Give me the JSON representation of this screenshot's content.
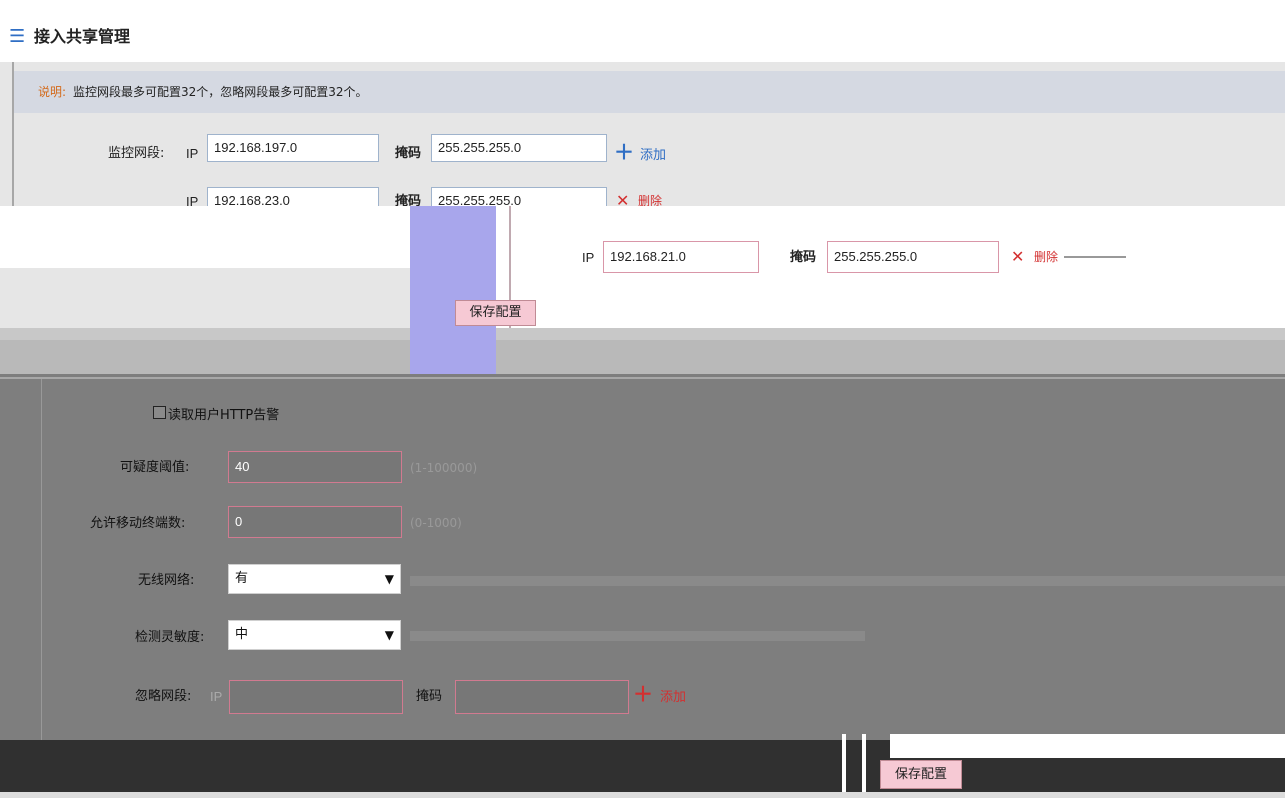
{
  "header": {
    "title": "接入共享管理"
  },
  "notice": {
    "label": "说明:",
    "text": "监控网段最多可配置32个，忽略网段最多可配置32个。"
  },
  "monitor": {
    "label": "监控网段:",
    "ip_prefix": "IP",
    "mask_label": "掩码",
    "rows": [
      {
        "ip": "192.168.197.0",
        "mask": "255.255.255.0",
        "action": "添加"
      },
      {
        "ip": "192.168.23.0",
        "mask": "255.255.255.0",
        "action": "删除"
      },
      {
        "ip": "192.168.21.0",
        "mask": "255.255.255.0",
        "action": "删除"
      }
    ]
  },
  "save_button_1": {
    "label": "保存配置"
  },
  "settings": {
    "http_alarm_label": "读取用户HTTP告警",
    "suspicion": {
      "label": "可疑度阈值:",
      "value": "40",
      "hint": "(1-100000)"
    },
    "mobile": {
      "label": "允许移动终端数:",
      "value": "0",
      "hint": "(0-1000)"
    },
    "wireless": {
      "label": "无线网络:",
      "value": "有"
    },
    "sensitivity": {
      "label": "检测灵敏度:",
      "value": "中"
    },
    "ignore": {
      "label": "忽略网段:",
      "ip_prefix": "IP",
      "mask_label": "掩码",
      "action": "添加"
    }
  },
  "save_button_2": {
    "label": "保存配置"
  },
  "colors": {
    "accent": "#2f6ec4",
    "notice_label": "#d46a1a",
    "plus": "#2f6ec4",
    "delete": "#d33030"
  }
}
